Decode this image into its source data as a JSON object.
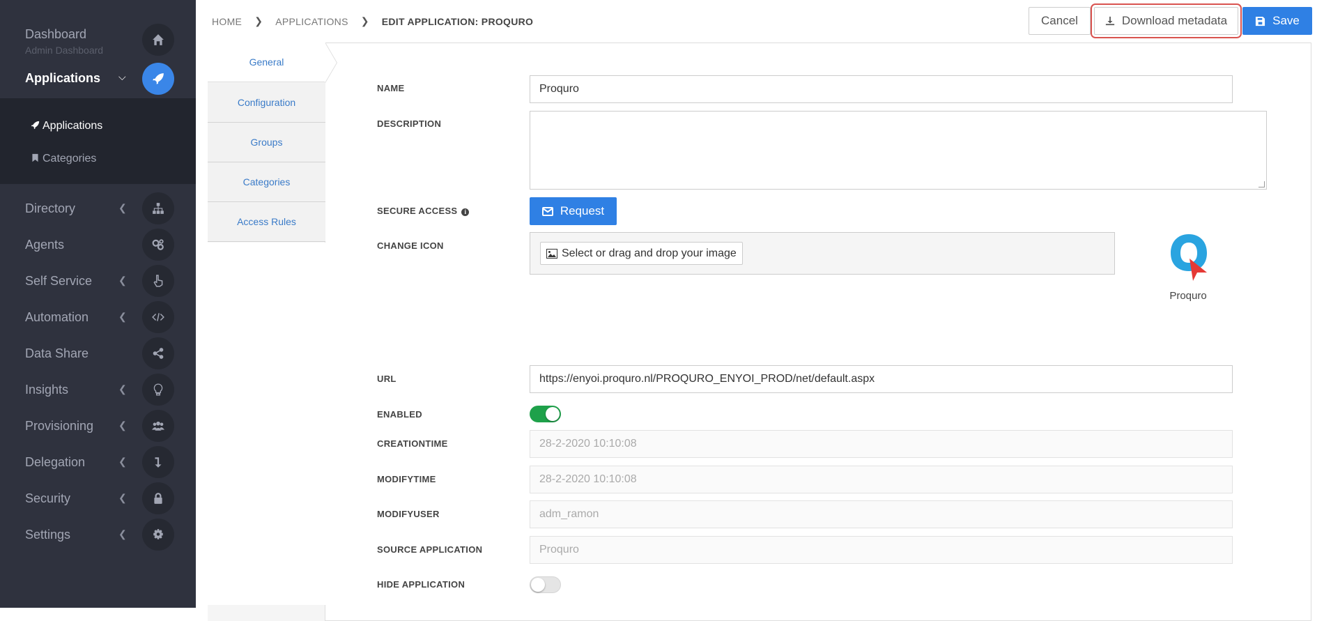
{
  "sidebar": {
    "dashboard": {
      "label": "Dashboard",
      "sublabel": "Admin Dashboard",
      "icon": "home-icon"
    },
    "applications": {
      "label": "Applications",
      "icon": "rocket-icon",
      "expanded": true,
      "children": [
        {
          "label": "Applications",
          "icon": "rocket-icon",
          "active": true
        },
        {
          "label": "Categories",
          "icon": "bookmark-icon"
        }
      ]
    },
    "items": [
      {
        "label": "Directory",
        "icon": "sitemap-icon",
        "has_children": true
      },
      {
        "label": "Agents",
        "icon": "cogs-icon",
        "has_children": false
      },
      {
        "label": "Self Service",
        "icon": "hand-pointer-icon",
        "has_children": true
      },
      {
        "label": "Automation",
        "icon": "code-icon",
        "has_children": true
      },
      {
        "label": "Data Share",
        "icon": "share-icon",
        "has_children": false
      },
      {
        "label": "Insights",
        "icon": "lightbulb-icon",
        "has_children": true
      },
      {
        "label": "Provisioning",
        "icon": "users-icon",
        "has_children": true
      },
      {
        "label": "Delegation",
        "icon": "level-down-icon",
        "has_children": true
      },
      {
        "label": "Security",
        "icon": "lock-icon",
        "has_children": true
      },
      {
        "label": "Settings",
        "icon": "gear-icon",
        "has_children": true
      }
    ]
  },
  "breadcrumb": [
    "HOME",
    "APPLICATIONS",
    "EDIT APPLICATION: PROQURO"
  ],
  "toolbar": {
    "cancel_label": "Cancel",
    "download_label": "Download metadata",
    "save_label": "Save"
  },
  "tabs": [
    "General",
    "Configuration",
    "Groups",
    "Categories",
    "Access Rules"
  ],
  "form": {
    "name_label": "NAME",
    "name_value": "Proquro",
    "description_label": "DESCRIPTION",
    "description_value": "",
    "secure_access_label": "SECURE ACCESS",
    "request_label": "Request",
    "change_icon_label": "CHANGE ICON",
    "select_image_label": "Select or drag and drop your image",
    "app_icon_name": "Proquro",
    "url_label": "URL",
    "url_value": "https://enyoi.proquro.nl/PROQURO_ENYOI_PROD/net/default.aspx",
    "enabled_label": "ENABLED",
    "enabled": true,
    "creationtime_label": "CREATIONTIME",
    "creationtime_value": "28-2-2020 10:10:08",
    "modifytime_label": "MODIFYTIME",
    "modifytime_value": "28-2-2020 10:10:08",
    "modifyuser_label": "MODIFYUSER",
    "modifyuser_value": "adm_ramon",
    "source_application_label": "SOURCE APPLICATION",
    "source_application_value": "Proquro",
    "hide_application_label": "HIDE APPLICATION",
    "hide_application": false
  },
  "colors": {
    "sidebar_bg": "#2f323e",
    "accent": "#2f80e4",
    "toggle_on": "#1ea14a",
    "highlight": "#d9534f"
  }
}
